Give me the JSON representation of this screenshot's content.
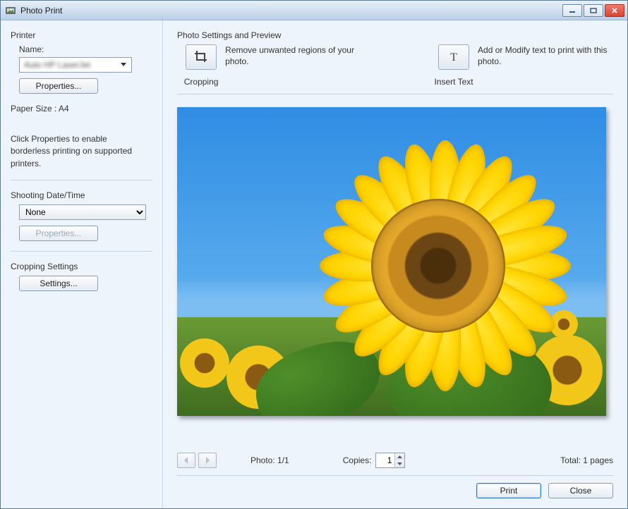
{
  "window": {
    "title": "Photo Print"
  },
  "sidebar": {
    "printer_section_label": "Printer",
    "name_label": "Name:",
    "printer_name": "Auto HP LaserJet",
    "properties_button": "Properties...",
    "paper_size_label": "Paper Size :",
    "paper_size_value": "A4",
    "hint": "Click Properties to enable borderless printing on supported printers.",
    "shooting_section_label": "Shooting Date/Time",
    "shooting_value": "None",
    "shooting_properties_button": "Properties...",
    "cropping_section_label": "Cropping Settings",
    "cropping_settings_button": "Settings..."
  },
  "main": {
    "settings_preview_label": "Photo Settings and Preview",
    "tools": {
      "cropping": {
        "caption": "Cropping",
        "desc": "Remove unwanted regions of your photo."
      },
      "insert_text": {
        "caption": "Insert Text",
        "desc": "Add or Modify text to print with this photo."
      }
    },
    "footer": {
      "photo_label": "Photo:",
      "photo_index": "1/1",
      "copies_label": "Copies:",
      "copies_value": "1",
      "total_label": "Total:",
      "total_pages": "1 pages"
    },
    "actions": {
      "print": "Print",
      "close": "Close"
    }
  }
}
